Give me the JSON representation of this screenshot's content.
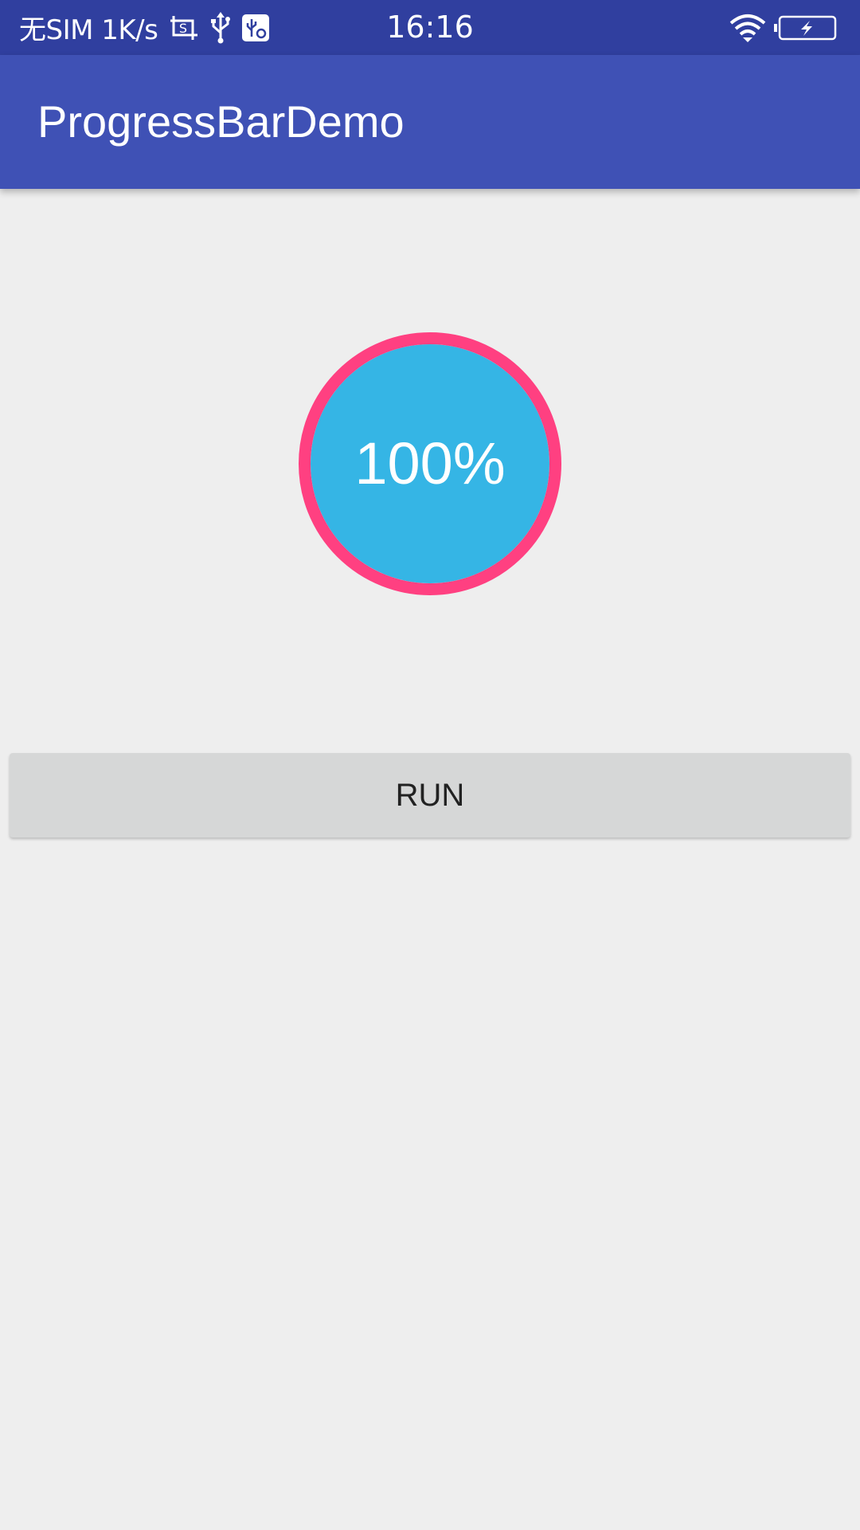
{
  "status_bar": {
    "carrier": "无SIM 1K/s",
    "time": "16:16",
    "icons": [
      "screenshot-icon",
      "usb-icon",
      "usb-debug-icon",
      "wifi-icon",
      "battery-charging-icon"
    ]
  },
  "app_bar": {
    "title": "ProgressBarDemo"
  },
  "progress": {
    "value": 1.0,
    "label": "100%",
    "fill_color": "#35b5e5",
    "ring_color": "#ff4081"
  },
  "run_button": {
    "label": "RUN"
  },
  "colors": {
    "status_bar": "#303f9f",
    "app_bar": "#3f51b5",
    "background": "#eeeeee",
    "button": "#d6d7d7"
  }
}
